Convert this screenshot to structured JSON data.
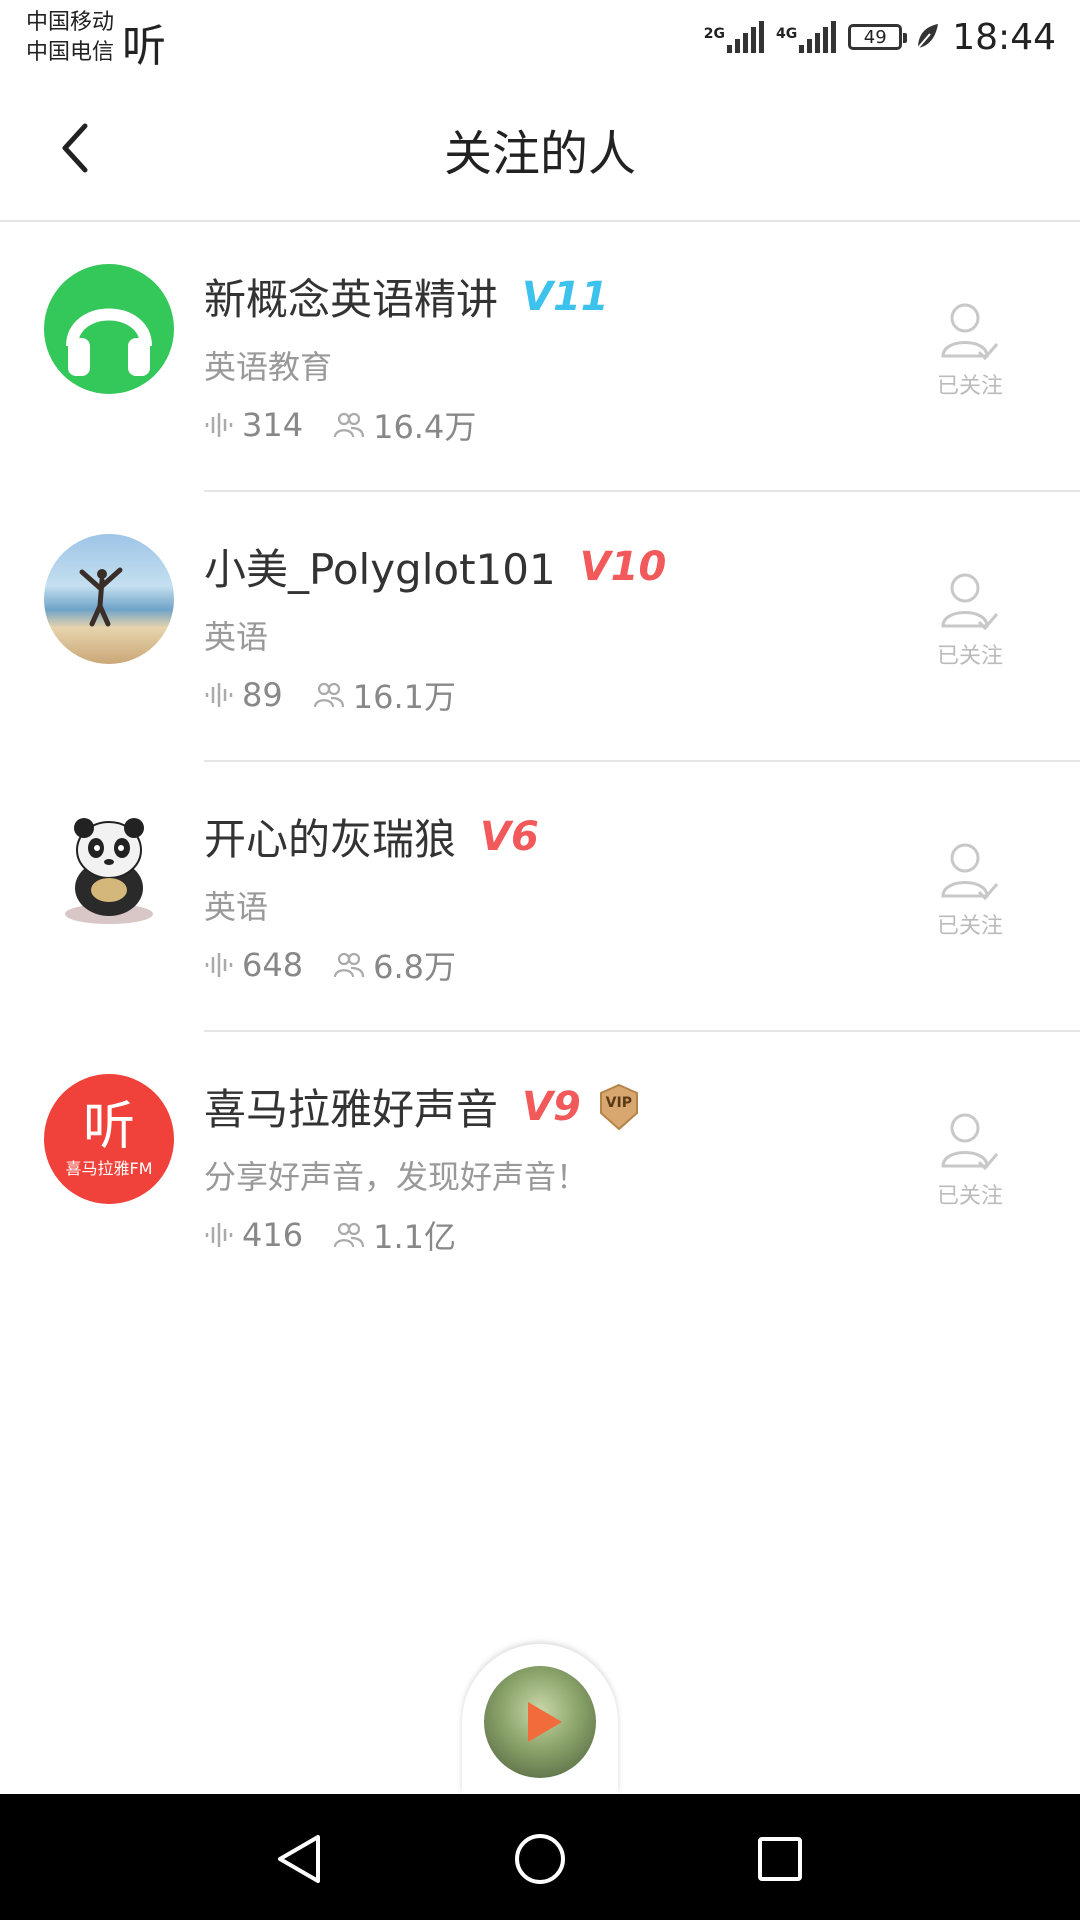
{
  "status": {
    "carrier1": "中国移动",
    "carrier2": "中国电信",
    "app_glyph": "听",
    "net1": "2G",
    "net2": "4G",
    "battery": "49",
    "time": "18:44"
  },
  "header": {
    "title": "关注的人",
    "back_icon": "chevron-left-icon"
  },
  "users": [
    {
      "name": "新概念英语精讲",
      "level": "V11",
      "level_color": "#3cc2ec",
      "desc": "英语教育",
      "tracks": "314",
      "fans": "16.4万",
      "follow_label": "已关注",
      "vip": false
    },
    {
      "name": "小美_Polyglot101",
      "level": "V10",
      "level_color": "#f2595b",
      "desc": "英语",
      "tracks": "89",
      "fans": "16.1万",
      "follow_label": "已关注",
      "vip": false
    },
    {
      "name": "开心的灰瑞狼",
      "level": "V6",
      "level_color": "#f2595b",
      "desc": "英语",
      "tracks": "648",
      "fans": "6.8万",
      "follow_label": "已关注",
      "vip": false
    },
    {
      "name": "喜马拉雅好声音",
      "level": "V9",
      "level_color": "#f2595b",
      "desc": "分享好声音，发现好声音！",
      "tracks": "416",
      "fans": "1.1亿",
      "follow_label": "已关注",
      "vip": true,
      "vip_label": "VIP"
    }
  ],
  "avatar4": {
    "glyph": "听",
    "text": "喜马拉雅FM"
  },
  "colors": {
    "accent": "#f2595b",
    "green": "#34c759",
    "xm_red": "#f0413a"
  }
}
